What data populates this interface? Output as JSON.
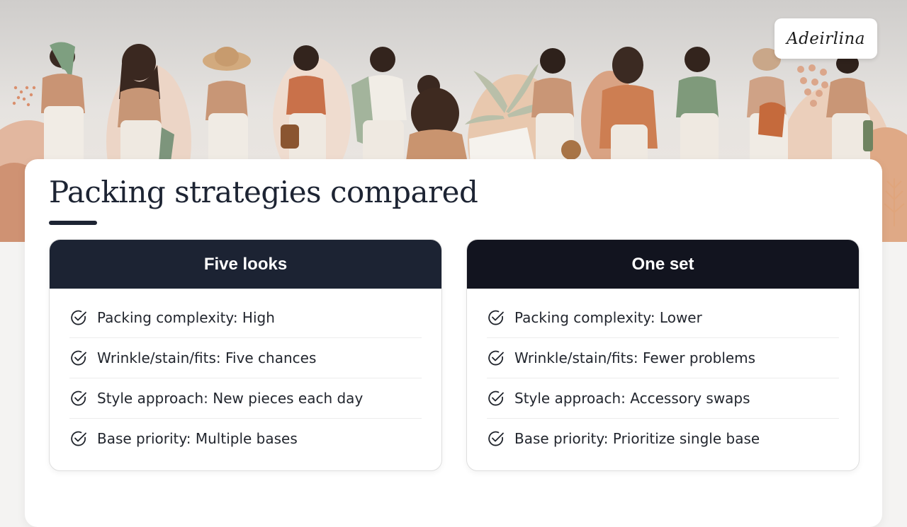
{
  "brand": {
    "name": "Adeirlina"
  },
  "slide": {
    "title": "Packing strategies compared"
  },
  "panels": [
    {
      "heading": "Five looks",
      "items": [
        "Packing complexity: High",
        "Wrinkle/stain/fits: Five chances",
        "Style approach: New pieces each day",
        "Base priority: Multiple bases"
      ]
    },
    {
      "heading": "One set",
      "items": [
        "Packing complexity: Lower",
        "Wrinkle/stain/fits: Fewer problems",
        "Style approach: Accessory swaps",
        "Base priority: Prioritize single base"
      ]
    }
  ],
  "icons": {
    "item_bullet": "check-circle-icon"
  },
  "colors": {
    "title": "#1d2433",
    "left_header": "#1c2333",
    "right_header": "#12141f",
    "accent_terracotta": "#c9714a",
    "accent_sage": "#8fa58a"
  }
}
